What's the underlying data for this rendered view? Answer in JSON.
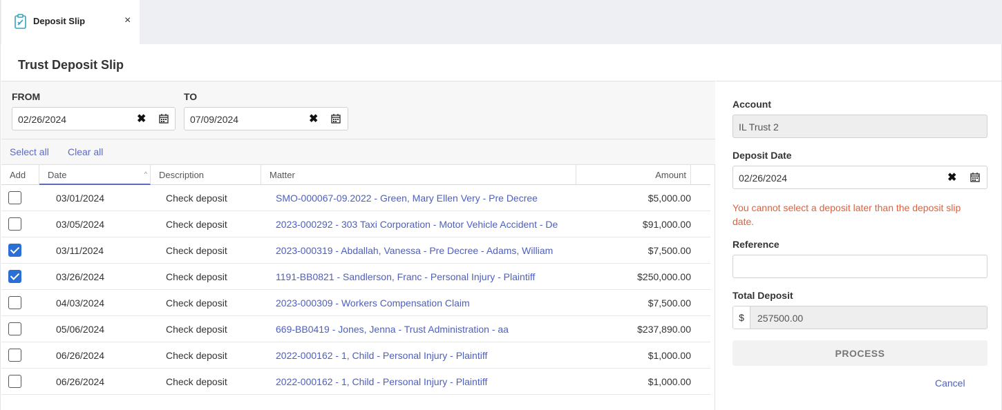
{
  "tab": {
    "label": "Deposit Slip",
    "close": "×"
  },
  "page": {
    "title": "Trust Deposit Slip"
  },
  "filter": {
    "from_label": "FROM",
    "from_value": "02/26/2024",
    "to_label": "TO",
    "to_value": "07/09/2024",
    "clear_glyph": "✖"
  },
  "links": {
    "select_all": "Select all",
    "clear_all": "Clear all"
  },
  "table": {
    "headers": {
      "add": "Add",
      "date": "Date",
      "description": "Description",
      "matter": "Matter",
      "amount": "Amount"
    },
    "sort_glyph": "^",
    "rows": [
      {
        "checked": false,
        "date": "03/01/2024",
        "description": "Check deposit",
        "matter": "SMO-000067-09.2022 - Green, Mary Ellen Very - Pre Decree",
        "amount": "$5,000.00"
      },
      {
        "checked": false,
        "date": "03/05/2024",
        "description": "Check deposit",
        "matter": "2023-000292 - 303 Taxi Corporation - Motor Vehicle Accident - De",
        "amount": "$91,000.00"
      },
      {
        "checked": true,
        "date": "03/11/2024",
        "description": "Check deposit",
        "matter": "2023-000319 - Abdallah, Vanessa - Pre Decree - Adams, William",
        "amount": "$7,500.00"
      },
      {
        "checked": true,
        "date": "03/26/2024",
        "description": "Check deposit",
        "matter": "1191-BB0821 - Sandlerson, Franc - Personal Injury - Plaintiff",
        "amount": "$250,000.00"
      },
      {
        "checked": false,
        "date": "04/03/2024",
        "description": "Check deposit",
        "matter": "2023-000309 - Workers Compensation Claim",
        "amount": "$7,500.00"
      },
      {
        "checked": false,
        "date": "05/06/2024",
        "description": "Check deposit",
        "matter": "669-BB0419 - Jones, Jenna - Trust Administration - aa",
        "amount": "$237,890.00"
      },
      {
        "checked": false,
        "date": "06/26/2024",
        "description": "Check deposit",
        "matter": "2022-000162 - 1, Child - Personal Injury - Plaintiff",
        "amount": "$1,000.00"
      },
      {
        "checked": false,
        "date": "06/26/2024",
        "description": "Check deposit",
        "matter": "2022-000162 - 1, Child - Personal Injury - Plaintiff",
        "amount": "$1,000.00"
      }
    ]
  },
  "form": {
    "account_label": "Account",
    "account_value": "IL Trust 2",
    "deposit_date_label": "Deposit Date",
    "deposit_date_value": "02/26/2024",
    "error": "You cannot select a deposit later than the deposit slip date.",
    "reference_label": "Reference",
    "reference_value": "",
    "total_label": "Total Deposit",
    "currency_symbol": "$",
    "total_value": "257500.00",
    "process_label": "PROCESS",
    "cancel_label": "Cancel"
  },
  "colors": {
    "accent": "#4c5fc1",
    "checkbox": "#2a6fd6",
    "error": "#e0603a"
  }
}
